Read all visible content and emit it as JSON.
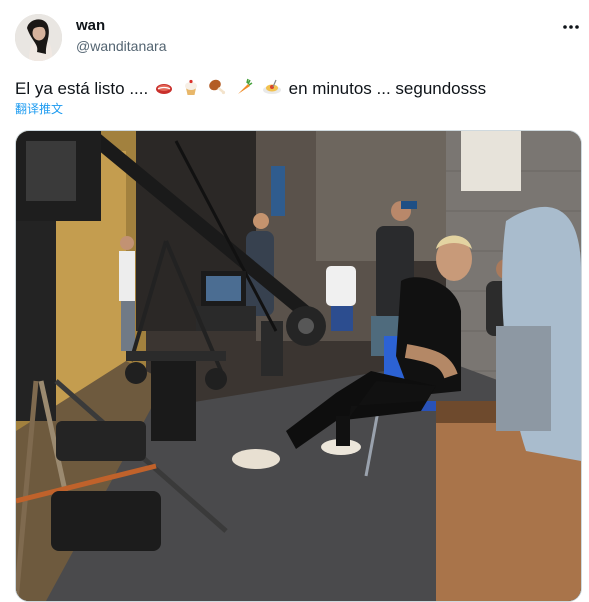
{
  "tweet": {
    "author": {
      "display_name": "wan",
      "handle": "@wanditanara",
      "avatar_icon": "avatar-photo"
    },
    "text_before": "El ya está listo ....",
    "emojis": [
      "meat-emoji",
      "cupcake-emoji",
      "drumstick-emoji",
      "carrot-emoji",
      "spaghetti-emoji"
    ],
    "text_after": "en minutos ... segundosss",
    "translate_label": "翻译推文",
    "more_icon": "more-options-icon",
    "photo": {
      "description_icon": "studio-set-photo"
    }
  },
  "colors": {
    "link": "#1d9bf0",
    "secondary_text": "#536471",
    "primary_text": "#0f1419"
  }
}
